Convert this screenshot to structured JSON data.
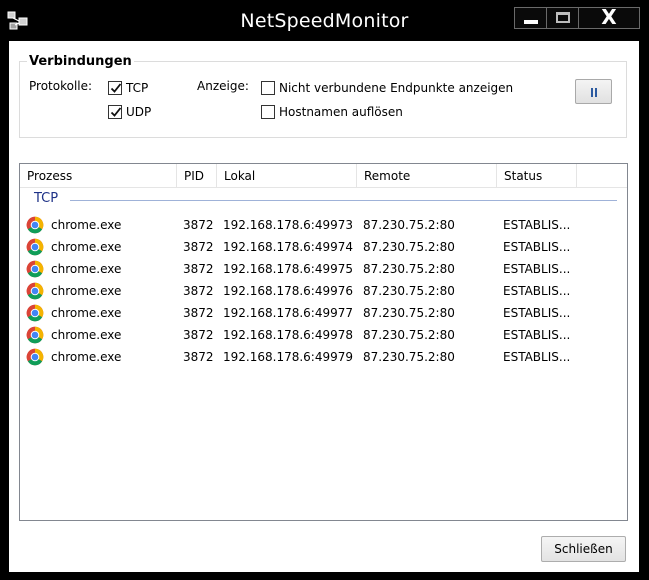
{
  "background": {
    "text": "Green"
  },
  "window": {
    "title": "NetSpeedMonitor"
  },
  "controls": {
    "minimize": "minimize-icon",
    "maximize": "maximize-icon",
    "close_glyph": "X"
  },
  "connections": {
    "title": "Verbindungen",
    "protocols_label": "Protokolle:",
    "tcp": {
      "label": "TCP",
      "checked": true
    },
    "udp": {
      "label": "UDP",
      "checked": true
    },
    "display_label": "Anzeige:",
    "show_unconnected": {
      "label": "Nicht verbundene Endpunkte anzeigen",
      "checked": false
    },
    "resolve_hostnames": {
      "label": "Hostnamen auflösen",
      "checked": false
    },
    "pause_icon": "pause-icon"
  },
  "table": {
    "columns": [
      "Prozess",
      "PID",
      "Lokal",
      "Remote",
      "Status"
    ],
    "group": "TCP",
    "rows": [
      {
        "process": "chrome.exe",
        "pid": "3872",
        "local": "192.168.178.6:49973",
        "remote": "87.230.75.2:80",
        "status": "ESTABLIS..."
      },
      {
        "process": "chrome.exe",
        "pid": "3872",
        "local": "192.168.178.6:49974",
        "remote": "87.230.75.2:80",
        "status": "ESTABLIS..."
      },
      {
        "process": "chrome.exe",
        "pid": "3872",
        "local": "192.168.178.6:49975",
        "remote": "87.230.75.2:80",
        "status": "ESTABLIS..."
      },
      {
        "process": "chrome.exe",
        "pid": "3872",
        "local": "192.168.178.6:49976",
        "remote": "87.230.75.2:80",
        "status": "ESTABLIS..."
      },
      {
        "process": "chrome.exe",
        "pid": "3872",
        "local": "192.168.178.6:49977",
        "remote": "87.230.75.2:80",
        "status": "ESTABLIS..."
      },
      {
        "process": "chrome.exe",
        "pid": "3872",
        "local": "192.168.178.6:49978",
        "remote": "87.230.75.2:80",
        "status": "ESTABLIS..."
      },
      {
        "process": "chrome.exe",
        "pid": "3872",
        "local": "192.168.178.6:49979",
        "remote": "87.230.75.2:80",
        "status": "ESTABLIS..."
      }
    ]
  },
  "footer": {
    "close_label": "Schließen"
  },
  "colors": {
    "titlebar": "#000000",
    "accent": "#1e3287",
    "group_line": "#9fb2d8"
  }
}
